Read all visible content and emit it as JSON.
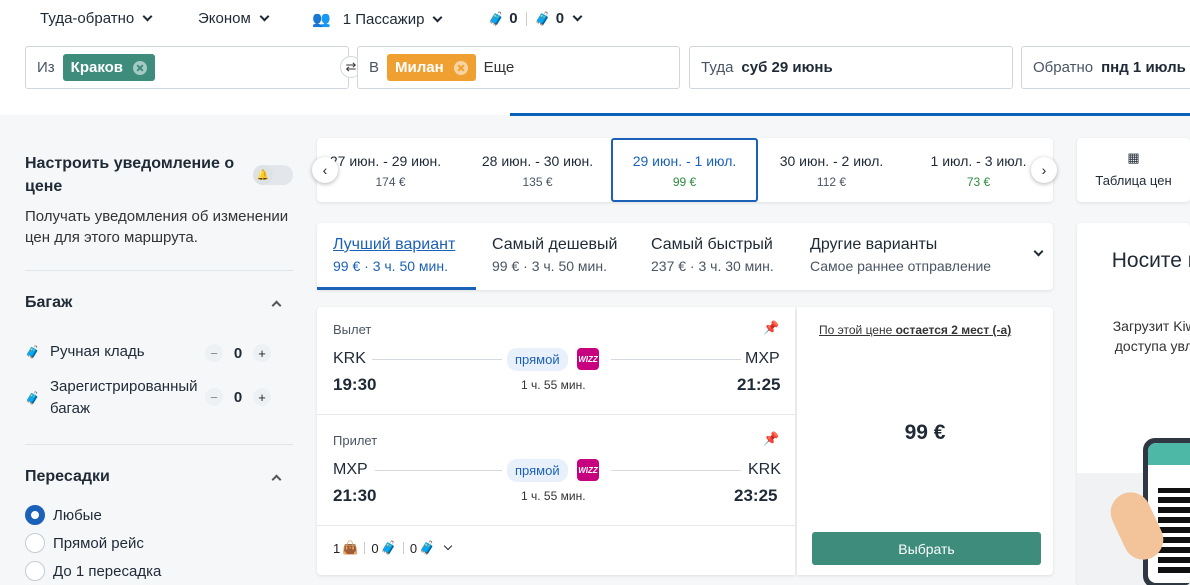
{
  "search": {
    "trip_type": "Туда-обратно",
    "cabin": "Эконом",
    "passengers": "1 Пассажир",
    "cabin_bags": "0",
    "checked_bags": "0",
    "from_label": "Из",
    "from_city": "Краков",
    "to_label": "В",
    "to_city": "Милан",
    "to_more": "Еще",
    "depart_label": "Туда",
    "depart_date": "суб 29 июнь",
    "return_label": "Обратно",
    "return_date": "пнд 1 июль"
  },
  "sidebar": {
    "alert_title": "Настроить уведомление о цене",
    "alert_desc": "Получать уведомления об изменении цен для этого маршрута.",
    "baggage_title": "Багаж",
    "cabin_bag_label": "Ручная кладь",
    "cabin_bag_count": "0",
    "checked_bag_label": "Зарегистрированный багаж",
    "checked_bag_count": "0",
    "stops_title": "Пересадки",
    "stops_options": [
      "Любые",
      "Прямой рейс",
      "До 1 пересадка"
    ]
  },
  "date_cards": [
    {
      "dates": "27 июн. - 29 июн.",
      "price": "174 €"
    },
    {
      "dates": "28 июн. - 30 июн.",
      "price": "135 €"
    },
    {
      "dates": "29 июн. - 1 июл.",
      "price": "99 €"
    },
    {
      "dates": "30 июн. - 2 июл.",
      "price": "112 €"
    },
    {
      "dates": "1 июл. - 3 июл.",
      "price": "73 €"
    }
  ],
  "price_table_label": "Таблица цен",
  "sort_tabs": [
    {
      "title": "Лучший вариант",
      "sub": "99 € · 3 ч. 50 мин."
    },
    {
      "title": "Самый дешевый",
      "sub": "99 € · 3 ч. 50 мин."
    },
    {
      "title": "Самый быстрый",
      "sub": "237 € · 3 ч. 30 мин."
    },
    {
      "title": "Другие варианты",
      "sub": "Самое раннее отправление"
    }
  ],
  "result": {
    "outbound": {
      "label": "Вылет",
      "from": "KRK",
      "to": "MXP",
      "dep": "19:30",
      "arr": "21:25",
      "type": "прямой",
      "duration": "1 ч. 55 мин."
    },
    "inbound": {
      "label": "Прилет",
      "from": "MXP",
      "to": "KRK",
      "dep": "21:30",
      "arr": "23:25",
      "type": "прямой",
      "duration": "1 ч. 55 мин."
    },
    "bags": {
      "personal": "1",
      "cabin": "0",
      "checked": "0"
    },
    "seats_prefix": "По этой цене ",
    "seats_bold": "остается 2 мест (-а)",
    "price": "99 €",
    "select_label": "Выбрать",
    "airline_logo_text": "WIZZ"
  },
  "promo": {
    "title": "Носите п ка",
    "text": "Загрузит Kiwi.com д доступа увлек путе"
  },
  "colors": {
    "accent": "#1b61b8",
    "from_chip": "#3d8c7c",
    "to_chip": "#f0a030",
    "select": "#3d8c7c",
    "green_price": "#2e8a3e"
  }
}
